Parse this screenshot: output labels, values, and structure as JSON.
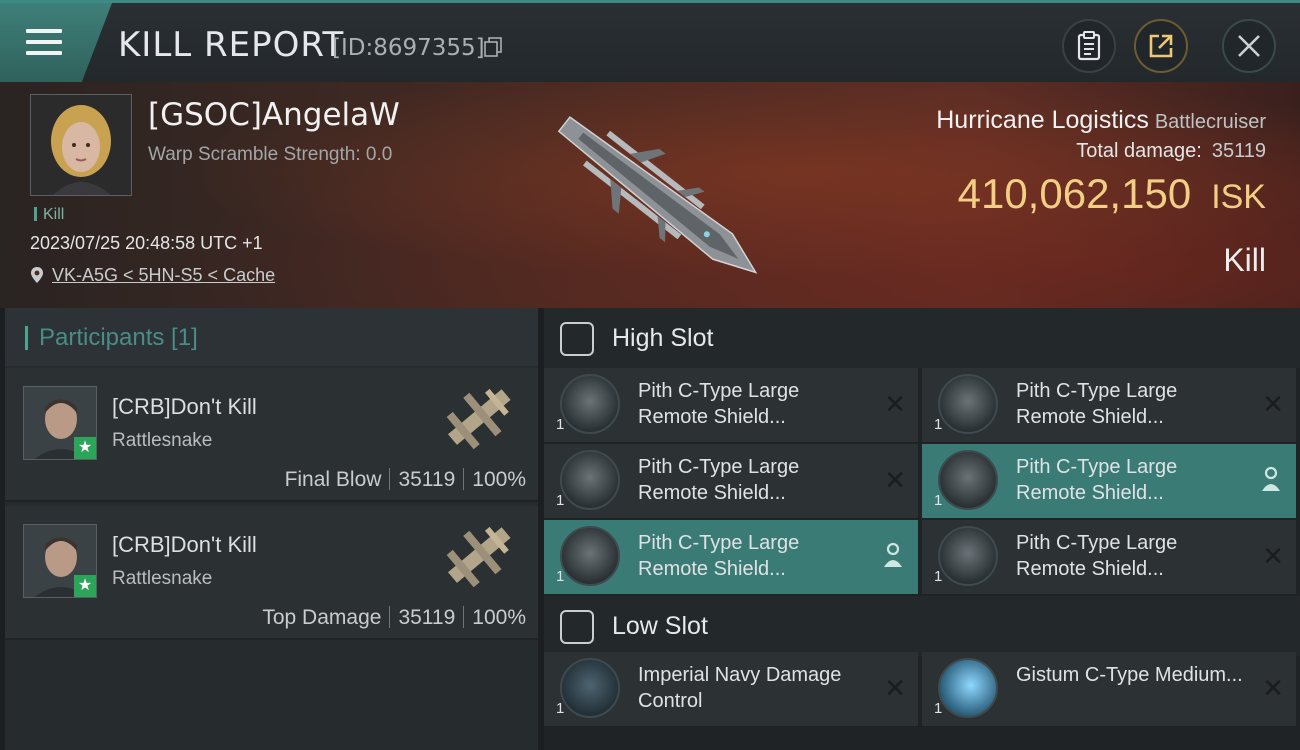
{
  "header": {
    "title": "KILL REPORT",
    "id_label": "[ID:8697355]"
  },
  "victim": {
    "name": "[GSOC]AngelaW",
    "warp_scramble": "Warp Scramble Strength: 0.0",
    "tag": "Kill",
    "timestamp": "2023/07/25 20:48:58 UTC +1",
    "location": "VK-A5G < 5HN-S5 < Cache"
  },
  "ship": {
    "name": "Hurricane Logistics",
    "class": "Battlecruiser",
    "total_damage_label": "Total damage:",
    "total_damage": "35119",
    "value": "410,062,150",
    "currency": "ISK",
    "result": "Kill"
  },
  "participants": {
    "header": "Participants [1]",
    "rows": [
      {
        "name": "[CRB]Don't Kill",
        "ship": "Rattlesnake",
        "role": "Final Blow",
        "damage": "35119",
        "percent": "100%"
      },
      {
        "name": "[CRB]Don't Kill",
        "ship": "Rattlesnake",
        "role": "Top Damage",
        "damage": "35119",
        "percent": "100%"
      }
    ]
  },
  "slots": {
    "high": {
      "label": "High Slot",
      "modules": [
        {
          "qty": "1",
          "name": "Pith C-Type Large Remote Shield...",
          "state": "destroyed"
        },
        {
          "qty": "1",
          "name": "Pith C-Type Large Remote Shield...",
          "state": "destroyed"
        },
        {
          "qty": "1",
          "name": "Pith C-Type Large Remote Shield...",
          "state": "destroyed"
        },
        {
          "qty": "1",
          "name": "Pith C-Type Large Remote Shield...",
          "state": "dropped"
        },
        {
          "qty": "1",
          "name": "Pith C-Type Large Remote Shield...",
          "state": "dropped"
        },
        {
          "qty": "1",
          "name": "Pith C-Type Large Remote Shield...",
          "state": "destroyed"
        }
      ]
    },
    "low": {
      "label": "Low Slot",
      "modules": [
        {
          "qty": "1",
          "name": "Imperial Navy Damage Control",
          "state": "destroyed"
        },
        {
          "qty": "1",
          "name": "Gistum C-Type Medium...",
          "state": "destroyed"
        }
      ]
    }
  },
  "colors": {
    "accent": "#3b7b76",
    "isk": "#f2cf84",
    "background": "#1f2326"
  }
}
